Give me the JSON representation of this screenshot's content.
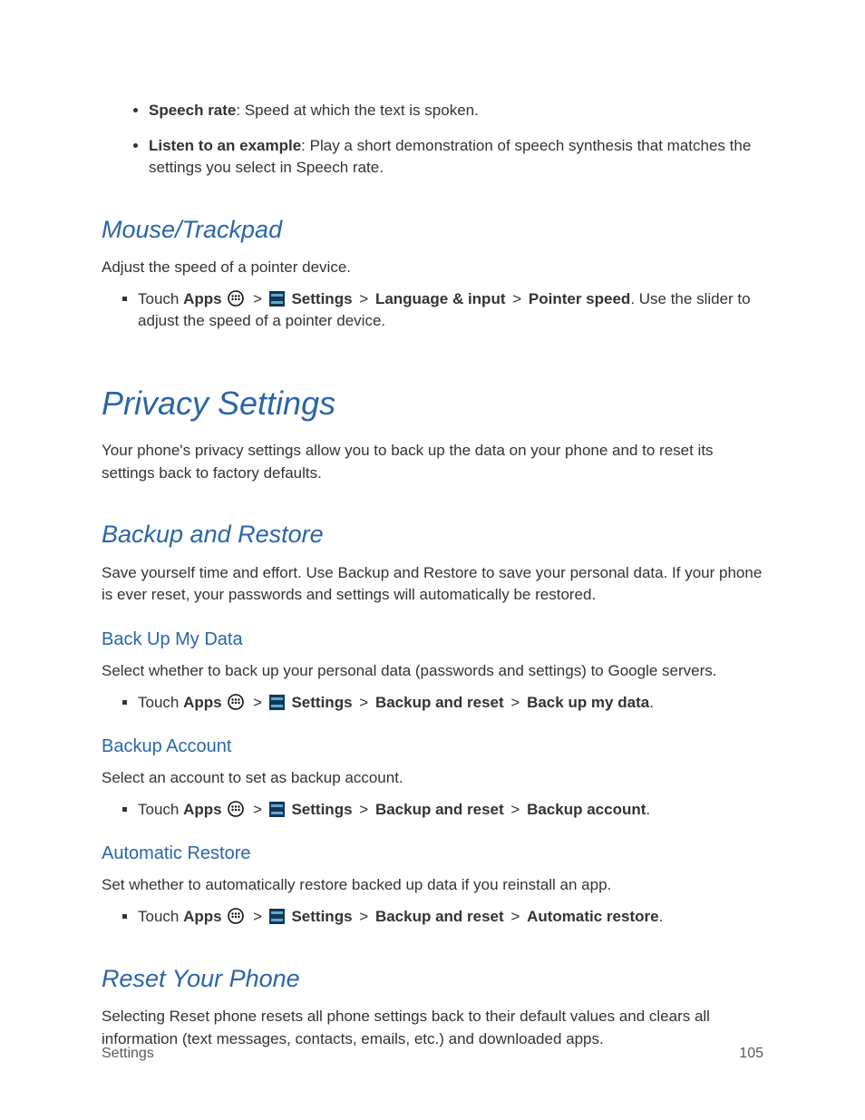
{
  "intro_bullets": [
    {
      "bold": "Speech rate",
      "rest": ": Speed at which the text is spoken."
    },
    {
      "bold": "Listen to an example",
      "rest": ": Play a short demonstration of speech synthesis that matches the settings you select in Speech rate."
    }
  ],
  "mouse": {
    "heading": "Mouse/Trackpad",
    "body": "Adjust the speed of a pointer device.",
    "step": {
      "prefix": "Touch ",
      "apps": "Apps",
      "settings": "Settings",
      "path1": "Language & input",
      "path2": "Pointer speed",
      "suffix": ". Use the slider to adjust the speed of a pointer device."
    }
  },
  "privacy": {
    "heading": "Privacy Settings",
    "body": "Your phone's privacy settings allow you to back up the data on your phone and to reset its settings back to factory defaults."
  },
  "backup_restore": {
    "heading": "Backup and Restore",
    "body": "Save yourself time and effort. Use Backup and Restore to save your personal data.  If your phone is ever reset, your passwords and settings will automatically be restored."
  },
  "backup_my_data": {
    "heading": "Back Up My Data",
    "body": "Select whether to back up your personal data (passwords and settings) to Google servers.",
    "step": {
      "prefix": "Touch ",
      "apps": "Apps",
      "settings": "Settings",
      "path1": "Backup and reset",
      "path2": "Back up my data",
      "suffix": "."
    }
  },
  "backup_account": {
    "heading": "Backup Account",
    "body": "Select an account to set as backup account.",
    "step": {
      "prefix": "Touch ",
      "apps": "Apps",
      "settings": "Settings",
      "path1": "Backup and reset",
      "path2": "Backup account",
      "suffix": "."
    }
  },
  "auto_restore": {
    "heading": "Automatic Restore",
    "body": "Set whether to automatically restore backed up data if you reinstall an app.",
    "step": {
      "prefix": "Touch ",
      "apps": "Apps",
      "settings": "Settings",
      "path1": "Backup and reset",
      "path2": "Automatic restore",
      "suffix": "."
    }
  },
  "reset": {
    "heading": "Reset Your Phone",
    "body": "Selecting Reset phone resets all phone settings back to their default values and clears all information (text messages, contacts, emails, etc.) and downloaded apps."
  },
  "footer": {
    "left": "Settings",
    "right": "105"
  },
  "gt": ">"
}
